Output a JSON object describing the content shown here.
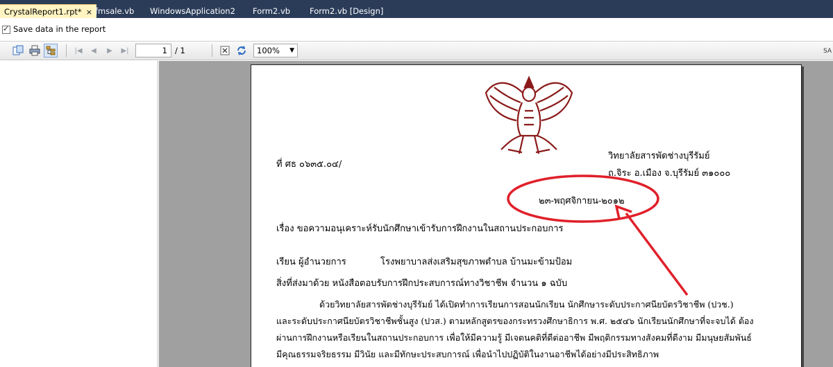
{
  "tabs": [
    {
      "label": "CrystalReport1.rpt*",
      "close": "×"
    },
    {
      "label": "fmsale.vb"
    },
    {
      "label": "WindowsApplication2"
    },
    {
      "label": "Form2.vb"
    },
    {
      "label": "Form2.vb [Design]"
    }
  ],
  "options": {
    "save_data_label": "Save data in the report"
  },
  "toolbar": {
    "current_page": "1",
    "total_pages": "/ 1",
    "zoom": "100%",
    "overflow_label": "SA",
    "icons": [
      "export-icon",
      "print-icon",
      "group-tree-toggle-icon",
      "first-page-icon",
      "previous-page-icon",
      "next-page-icon",
      "last-page-icon",
      "stop-icon",
      "refresh-icon"
    ]
  },
  "document": {
    "ref_no": "ที่  ศธ  ๐๖๓๕.๐๔/",
    "org_name": "วิทยาลัยสารพัดช่างบุรีรัมย์",
    "org_address": "ถ.จิระ  อ.เมือง  จ.บุรีรัมย์   ๓๑๐๐๐",
    "date": "๒๓-พฤศจิกายน-๒๐๑๒",
    "subject": "เรื่อง   ขอความอนุเคราะห์รับนักศึกษาเข้ารับการฝึกงานในสถานประกอบการ",
    "to_label": "เรียน   ผู้อำนวยการ",
    "to_org": "โรงพยาบาลส่งเสริมสุขภาพตำบล บ้านมะข้ามป้อม",
    "enclosure": "สิ่งที่ส่งมาด้วย    หนังสือตอบรับการฝึกประสบการณ์ทางวิชาชีพ   จำนวน   ๑   ฉบับ",
    "body_lines": [
      "ด้วยวิทยาลัยสารพัดช่างบุรีรัมย์  ได้เปิดทำการเรียนการสอนนักเรียน  นักศึกษาระดับประกาศนียบัตรวิชาชีพ (ปวช.)",
      "และระดับประกาศนียบัตรวิชาชีพชั้นสูง (ปวส.) ตามหลักสูตรของกระทรวงศึกษาธิการ พ.ศ. ๒๕๔๖ นักเรียนนักศึกษาที่จะจบได้ ต้อง",
      "ผ่านการฝึกงานหรือเรียนในสถานประกอบการ เพื่อให้มีความรู้ มีเจตนคติที่ดีต่ออาชีพ  มีพฤติกรรมทางสังคมที่ดีงาม มีมนุษยสัมพันธ์",
      "มีคุณธรรมจริยธรรม มีวินัย และมีทักษะประสบการณ์  เพื่อนำไปปฏิบัติในงานอาชีพได้อย่างมีประสิทธิภาพ"
    ]
  },
  "colors": {
    "tabstrip": "#2b3c59",
    "active_tab": "#fff4c2",
    "viewer_bg": "#a0a0a0",
    "annotation": "#e0202a",
    "seal": "#8b1a1a"
  }
}
